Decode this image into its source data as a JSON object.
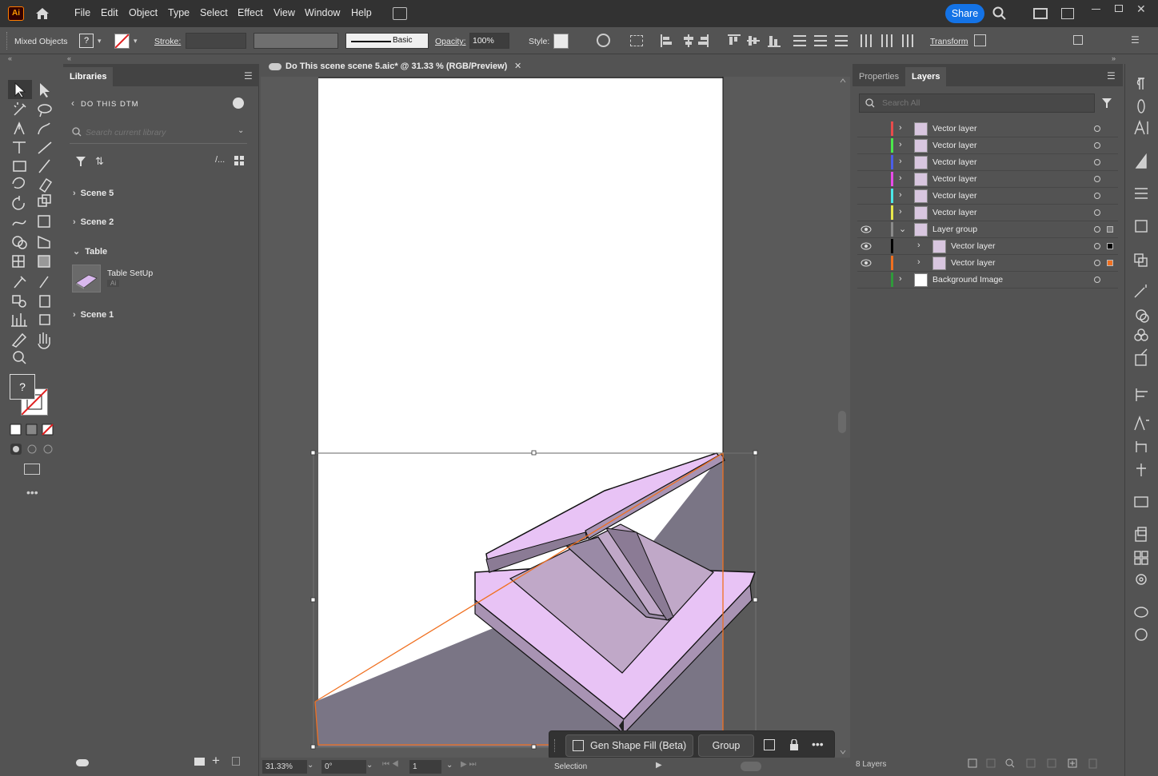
{
  "app": {
    "logo_text": "Ai"
  },
  "menu": [
    "File",
    "Edit",
    "Object",
    "Type",
    "Select",
    "Effect",
    "View",
    "Window",
    "Help"
  ],
  "header": {
    "share_label": "Share"
  },
  "controlbar": {
    "selection_type": "Mixed Objects",
    "stroke_label": "Stroke:",
    "brush_label": "Basic",
    "opacity_label": "Opacity:",
    "opacity_value": "100%",
    "style_label": "Style:",
    "transform_label": "Transform"
  },
  "libraries": {
    "tab_label": "Libraries",
    "library_name": "DO THIS DTM",
    "search_placeholder": "Search current library",
    "groups": [
      {
        "label": "Scene 5",
        "expanded": false
      },
      {
        "label": "Scene 2",
        "expanded": false
      },
      {
        "label": "Table",
        "expanded": true
      },
      {
        "label": "Scene 1",
        "expanded": false
      }
    ],
    "asset": {
      "name": "Table SetUp",
      "type": "Ai"
    }
  },
  "document": {
    "tab_title": "Do This scene scene 5.aic* @ 31.33 % (RGB/Preview)",
    "zoom": "31.33%",
    "rotation": "0°",
    "artboard": "1",
    "status_tool": "Selection"
  },
  "layers_panel": {
    "tabs": [
      "Properties",
      "Layers"
    ],
    "active_tab": "Layers",
    "search_placeholder": "Search All",
    "layers": [
      {
        "name": "Vector layer",
        "color": "#e84b4b",
        "visible": false,
        "level": 0
      },
      {
        "name": "Vector layer",
        "color": "#4be84b",
        "visible": false,
        "level": 0
      },
      {
        "name": "Vector layer",
        "color": "#4b5ee8",
        "visible": false,
        "level": 0
      },
      {
        "name": "Vector layer",
        "color": "#e84be8",
        "visible": false,
        "level": 0
      },
      {
        "name": "Vector layer",
        "color": "#4be8e8",
        "visible": false,
        "level": 0
      },
      {
        "name": "Vector layer",
        "color": "#e8e84b",
        "visible": false,
        "level": 0
      },
      {
        "name": "Layer group",
        "color": "#8a8a8a",
        "visible": true,
        "level": 0,
        "expanded": true
      },
      {
        "name": "Vector layer",
        "color": "#000000",
        "visible": true,
        "level": 1
      },
      {
        "name": "Vector layer",
        "color": "#f07020",
        "visible": true,
        "level": 1
      },
      {
        "name": "Background Image",
        "color": "#2f9a3a",
        "visible": false,
        "level": 0
      }
    ],
    "count_label": "8 Layers"
  },
  "taskbar": {
    "gen_fill_label": "Gen Shape Fill (Beta)",
    "group_label": "Group"
  },
  "colors": {
    "accent": "#1473e6",
    "selection": "#f07020",
    "table_fill": "#e8c3f5",
    "shadow_fill": "#7a7585"
  }
}
